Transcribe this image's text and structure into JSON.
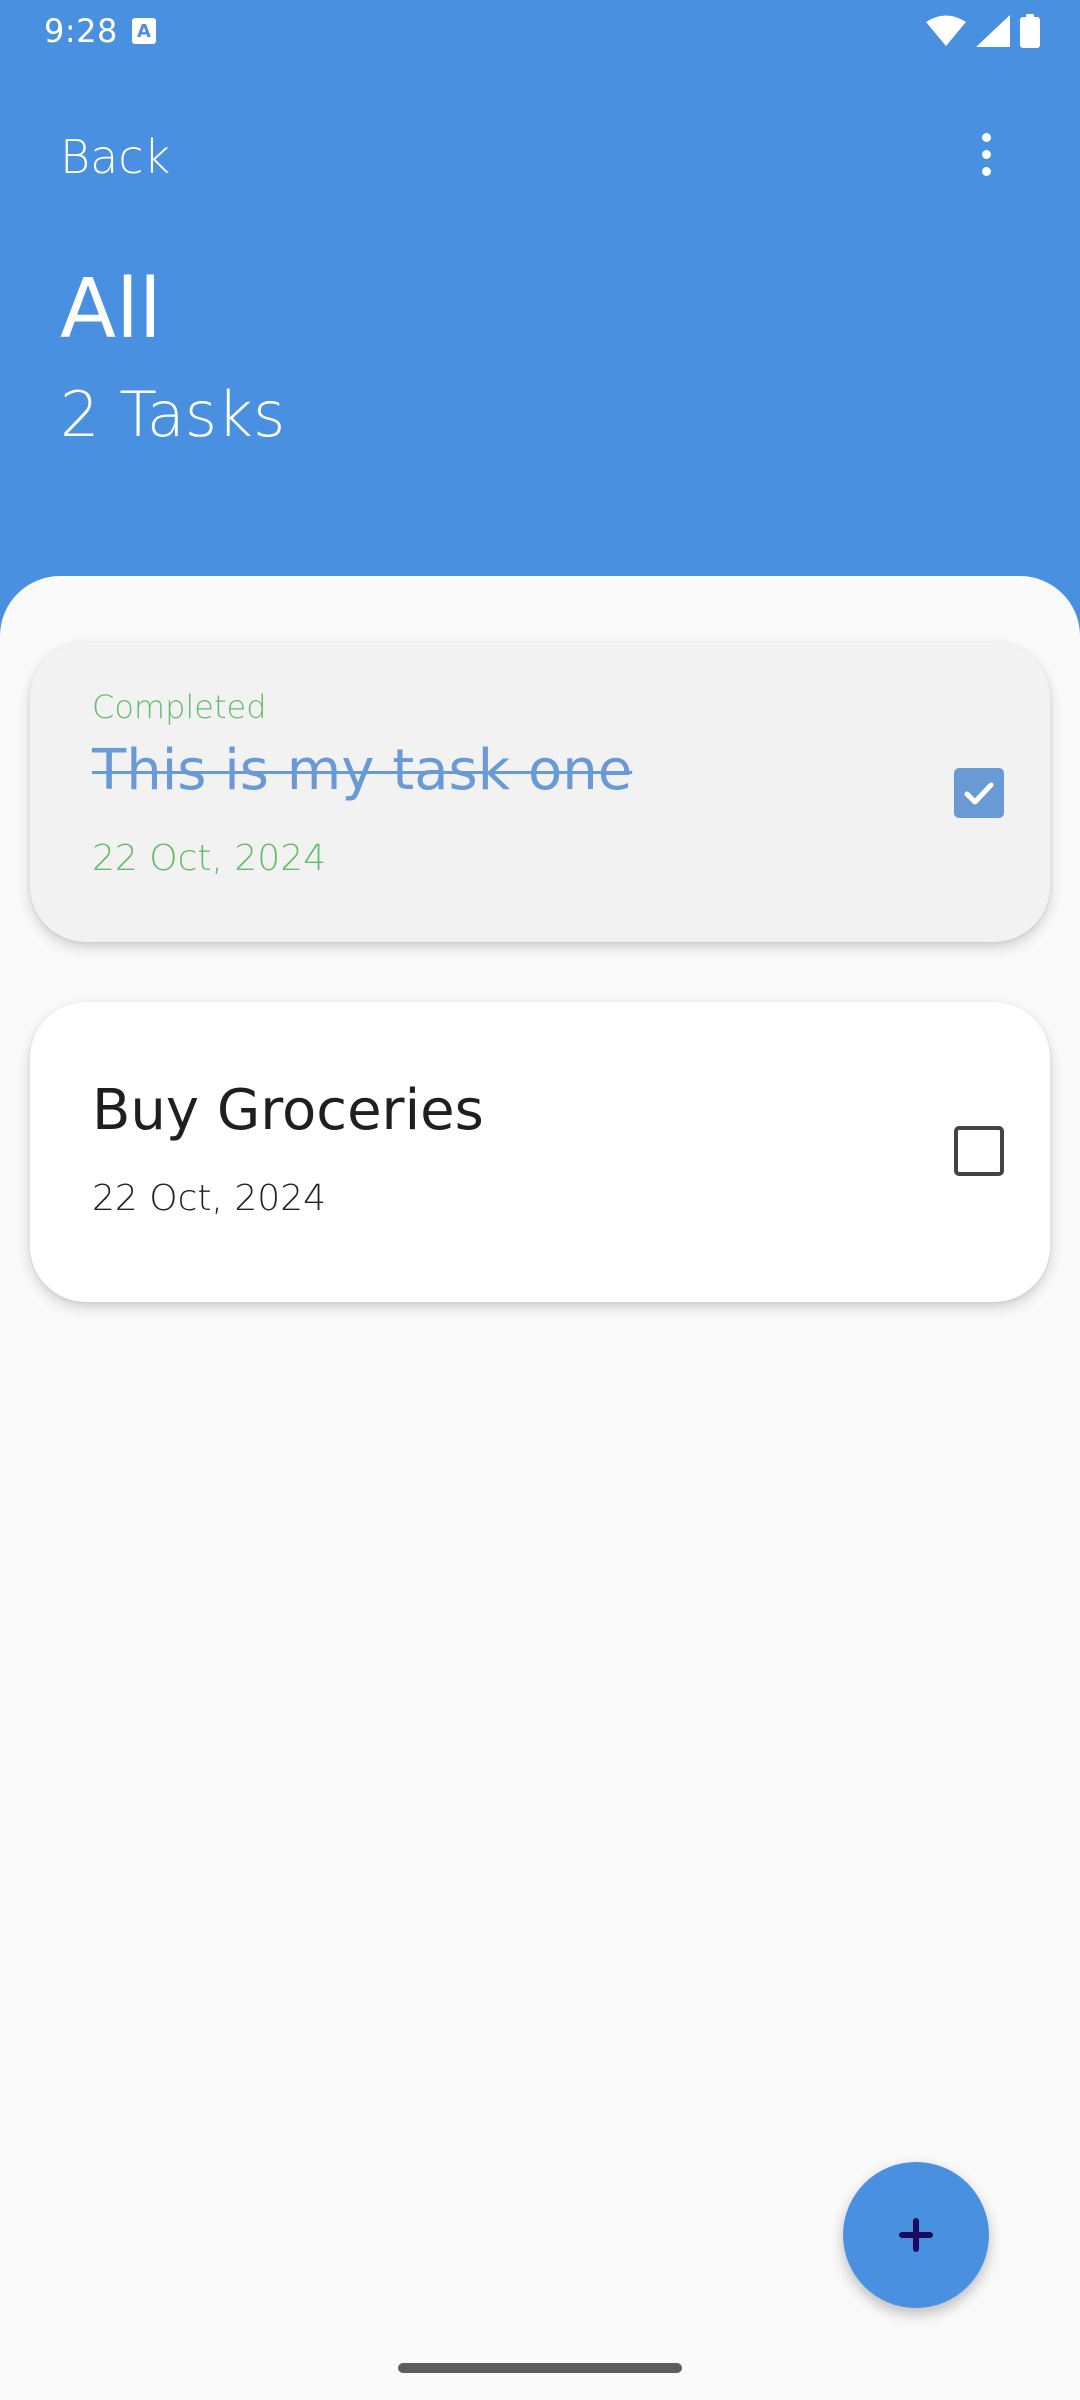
{
  "status_bar": {
    "time": "9:28",
    "notification_icon": "a-badge-icon",
    "icons": [
      "wifi-icon",
      "signal-icon",
      "battery-icon"
    ]
  },
  "header": {
    "back_label": "Back",
    "menu_icon": "more-vert-icon",
    "title": "All",
    "task_count": "2 Tasks"
  },
  "tasks": [
    {
      "status": "Completed",
      "title": "This is my task one",
      "date": "22 Oct, 2024",
      "checked": true
    },
    {
      "status": "",
      "title": "Buy Groceries",
      "date": "22 Oct, 2024",
      "checked": false
    }
  ],
  "fab": {
    "icon": "plus-icon"
  },
  "colors": {
    "primary": "#4a90e0",
    "completed_text": "#6a9ad6",
    "completed_label": "#66bb6a",
    "fab_icon": "#1a0b5e",
    "background": "#fafafa"
  }
}
